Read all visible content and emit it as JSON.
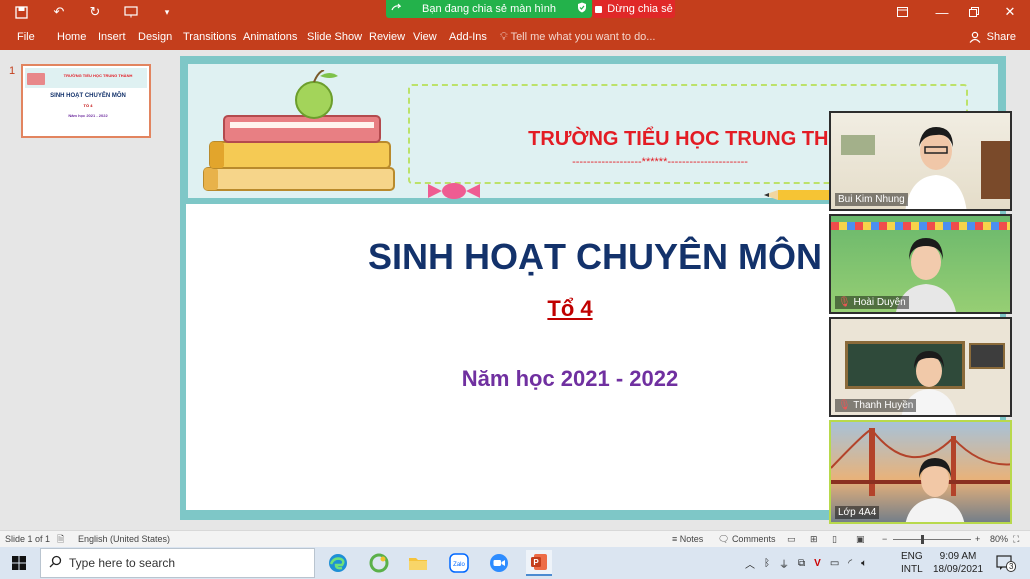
{
  "app": {
    "share_status": "Bạn đang chia sẻ màn hình",
    "stop_share": "Dừng chia sẻ"
  },
  "ribbon": {
    "tabs": [
      "File",
      "Home",
      "Insert",
      "Design",
      "Transitions",
      "Animations",
      "Slide Show",
      "Review",
      "View",
      "Add-Ins"
    ],
    "tell_me": "Tell me what you want to do...",
    "share": "Share"
  },
  "thumbnails": {
    "number": "1",
    "school": "TRƯỜNG TIỂU HỌC TRUNG THÀNH",
    "title": "SINH HOẠT CHUYÊN MÔN",
    "group": "TỔ 4",
    "year": "Năm học 2021 - 2022"
  },
  "slide": {
    "school": "TRƯỜNG TIỂU HỌC TRUNG THÀNH",
    "stars": "-------------------******----------------------",
    "title": "SINH HOẠT CHUYÊN MÔN",
    "group": "Tổ 4",
    "year": "Năm học 2021 - 2022"
  },
  "participants": [
    {
      "name": "Bui Kim Nhung"
    },
    {
      "name": "Hoài Duyên"
    },
    {
      "name": "Thanh Huyền"
    },
    {
      "name": "Lớp 4A4"
    }
  ],
  "status": {
    "slide": "Slide 1 of 1",
    "language": "English (United States)",
    "notes": "Notes",
    "comments": "Comments",
    "zoom": "80%"
  },
  "taskbar": {
    "search_placeholder": "Type here to search",
    "lang1": "ENG",
    "lang2": "INTL",
    "time": "9:09 AM",
    "date": "18/09/2021",
    "notif": "3"
  },
  "colors": {
    "office_accent": "#c43e1c",
    "school_red": "#e31c24",
    "title_navy": "#13326b",
    "year_purple": "#7030a0",
    "share_green": "#23b24b"
  }
}
